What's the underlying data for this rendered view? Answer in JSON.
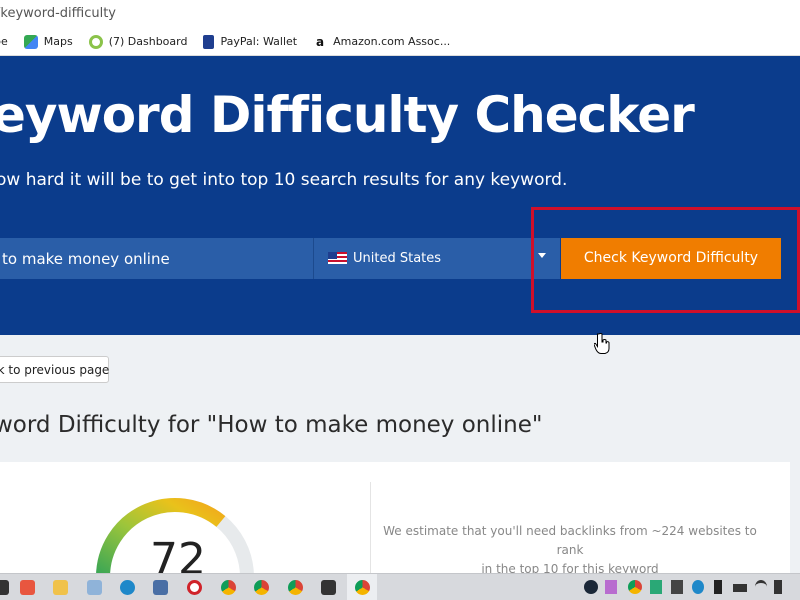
{
  "browser": {
    "url": "/keyword-difficulty",
    "bookmarks": [
      {
        "label": "be",
        "icon": "youtube-icon",
        "color": "#ff0000"
      },
      {
        "label": "Maps",
        "icon": "maps-icon",
        "color": "#34a853"
      },
      {
        "label": "(7) Dashboard",
        "icon": "dashboard-icon",
        "color": "#8bc34a"
      },
      {
        "label": "PayPal: Wallet",
        "icon": "paypal-icon",
        "color": "#1f3e8f"
      },
      {
        "label": "Amazon.com Assoc...",
        "icon": "amazon-icon",
        "color": "#111111"
      }
    ]
  },
  "hero": {
    "title": "eyword Difficulty Checker",
    "subtitle": "ow hard it will be to get into top 10 search results for any keyword.",
    "keyword_value": " to make money online",
    "country": "United States",
    "check_button": "Check Keyword Difficulty"
  },
  "content": {
    "back_button": "ck to previous page",
    "result_title": "word Difficulty for \"How to make money online\"",
    "score": "72",
    "score_fraction": 0.72,
    "estimate_line1": "We estimate that you'll need backlinks from ~224 websites to rank",
    "estimate_line2": "in the top 10 for this keyword"
  },
  "colors": {
    "hero_bg": "#0b3c8c",
    "button_orange": "#f07d00",
    "highlight_red": "#d0102a"
  },
  "taskbar": {
    "icons": [
      "app-icon",
      "office-icon",
      "file-explorer-icon",
      "notepad-icon",
      "edge-icon",
      "network-icon",
      "opera-icon",
      "chrome-icon",
      "chrome-icon",
      "chrome-icon",
      "store-icon",
      "chrome-icon"
    ],
    "tray_icons": [
      "steam-icon",
      "app-icon",
      "chrome-icon",
      "app-icon",
      "shield-icon",
      "app-icon",
      "phone-icon",
      "battery-icon",
      "wifi-icon",
      "volume-icon"
    ]
  }
}
